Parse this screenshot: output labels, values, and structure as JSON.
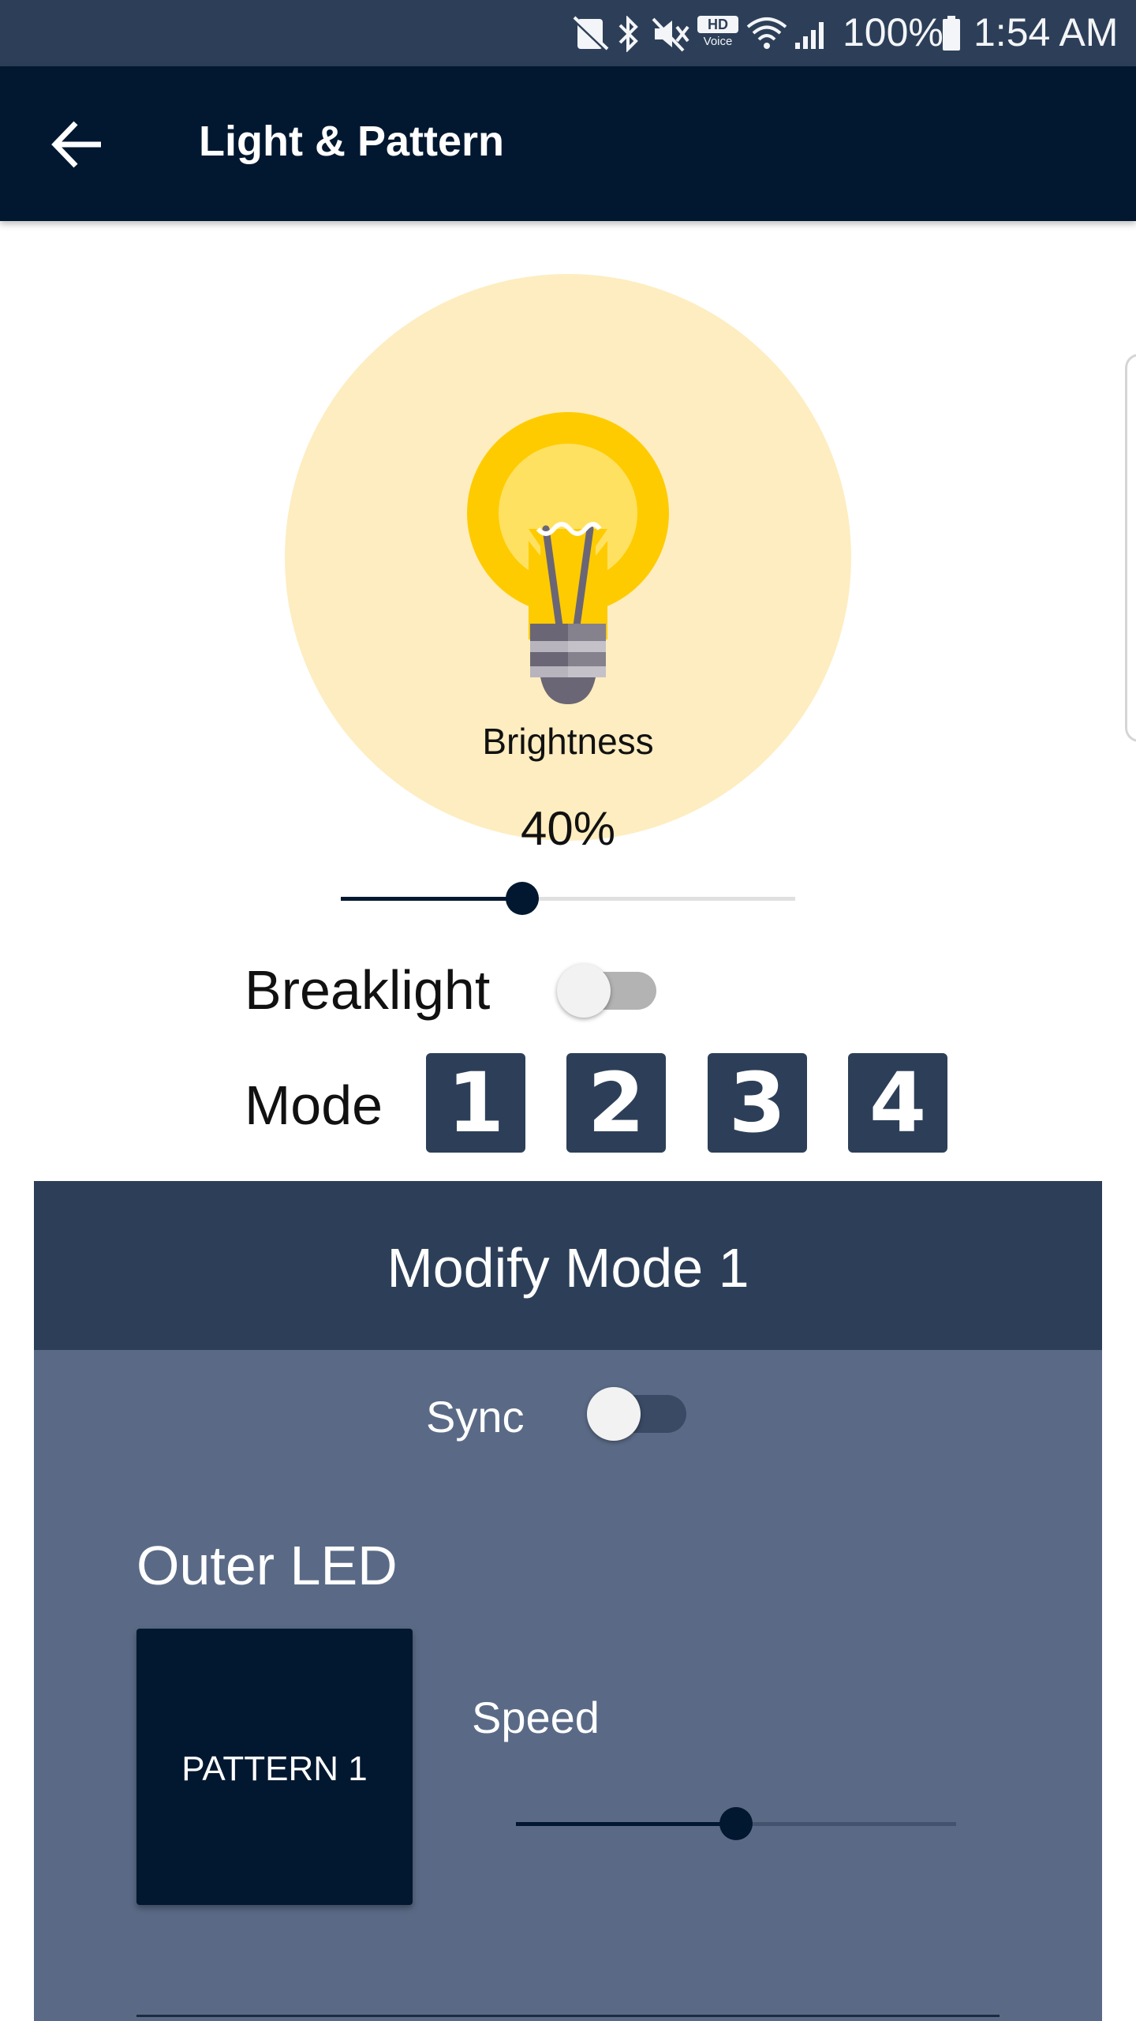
{
  "status_bar": {
    "battery_percent": "100%",
    "time": "1:54 AM",
    "icons": [
      "no-sim-icon",
      "bluetooth-icon",
      "mute-icon",
      "hd-voice-icon",
      "wifi-icon",
      "signal-icon",
      "battery-icon"
    ],
    "hd_text": "HD",
    "voice_text": "Voice"
  },
  "app_bar": {
    "title": "Light & Pattern",
    "back_icon": "arrow-left-icon"
  },
  "brightness": {
    "label": "Brightness",
    "value_text": "40%",
    "slider_fraction": 0.4
  },
  "breaklight": {
    "label": "Breaklight",
    "on": false
  },
  "mode": {
    "label": "Mode",
    "buttons": [
      "1",
      "2",
      "3",
      "4"
    ]
  },
  "modify_panel": {
    "title": "Modify Mode 1",
    "sync": {
      "label": "Sync",
      "on": false
    },
    "outer_led": {
      "label": "Outer LED",
      "pattern_button": "PATTERN 1",
      "speed_label": "Speed",
      "speed_fraction": 0.5
    }
  },
  "colors": {
    "primary_dark": "#021830",
    "panel_header": "#2d3f58",
    "panel_body": "#5a6a86",
    "bulb_glow": "#fdedc0",
    "bulb_yellow": "#fecb00"
  }
}
